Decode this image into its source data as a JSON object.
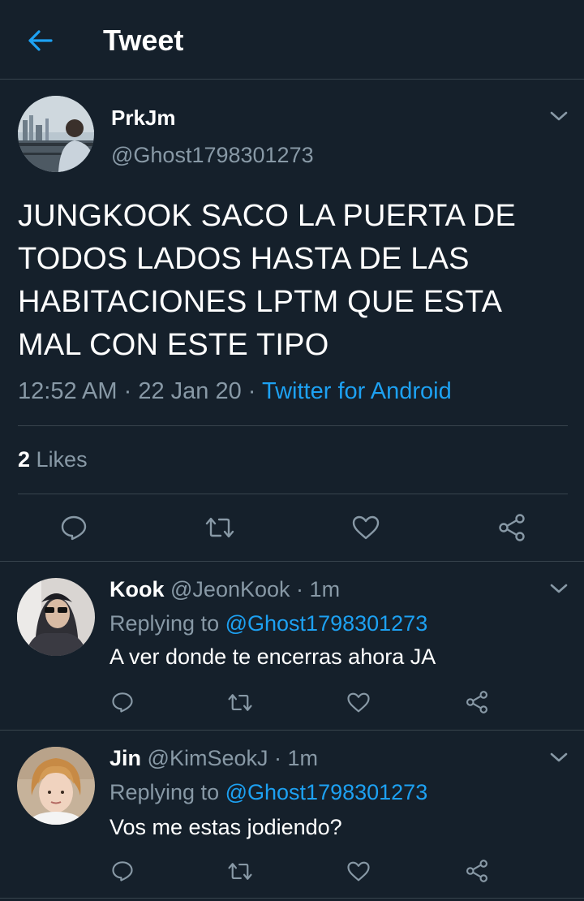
{
  "header": {
    "title": "Tweet",
    "back_icon": "arrow-left-icon"
  },
  "tweet": {
    "display_name": "PrkJm",
    "handle": "@Ghost1798301273",
    "text_lines": [
      "JUNGKOOK SACO LA PUERTA DE",
      "TODOS LADOS HASTA DE LAS",
      "HABITACIONES LPTM QUE ESTA",
      "MAL CON ESTE TIPO"
    ],
    "time": "12:52 AM",
    "sep": "·",
    "date": "22 Jan 20",
    "source": "Twitter for Android",
    "likes_count": "2",
    "likes_label": "Likes"
  },
  "replies": [
    {
      "display_name": "Kook",
      "handle": "@JeonKook",
      "time": "1m",
      "replying_prefix": "Replying to",
      "replying_to": "@Ghost1798301273",
      "text": "A ver donde te encerras ahora JA"
    },
    {
      "display_name": "Jin",
      "handle": "@KimSeokJ",
      "time": "1m",
      "replying_prefix": "Replying to",
      "replying_to": "@Ghost1798301273",
      "text": "Vos me estas jodiendo?"
    }
  ],
  "colors": {
    "background": "#15202b",
    "divider": "#38444d",
    "muted": "#8899a6",
    "accent": "#1da1f2"
  }
}
